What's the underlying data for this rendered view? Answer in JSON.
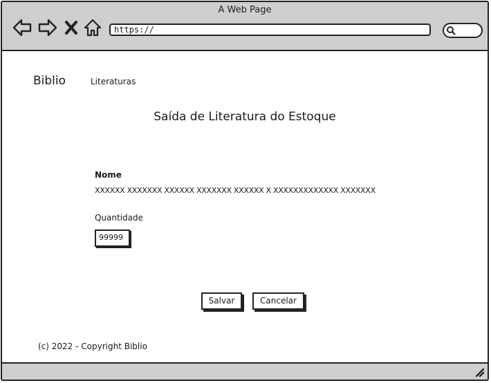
{
  "browser": {
    "title": "A Web Page",
    "url": "https://",
    "icons": [
      "back-arrow-icon",
      "forward-arrow-icon",
      "close-icon",
      "home-icon",
      "search-icon",
      "resize-grip-icon"
    ]
  },
  "header": {
    "brand": "Biblio",
    "nav_items": [
      {
        "label": "Literaturas"
      }
    ]
  },
  "main": {
    "title": "Saída de Literatura do Estoque",
    "name_label": "Nome",
    "name_value": "XXXXXX XXXXXXX XXXXXX  XXXXXXX XXXXXX X XXXXXXXXXXXXX XXXXXXX",
    "quantity_label": "Quantidade",
    "quantity_value": "99999",
    "save_label": "Salvar",
    "cancel_label": "Cancelar"
  },
  "footer": {
    "text": "(c) 2022 - Copyright Biblio"
  },
  "colors": {
    "chrome": "#cfcfcf",
    "stroke": "#222222",
    "background": "#ffffff"
  }
}
